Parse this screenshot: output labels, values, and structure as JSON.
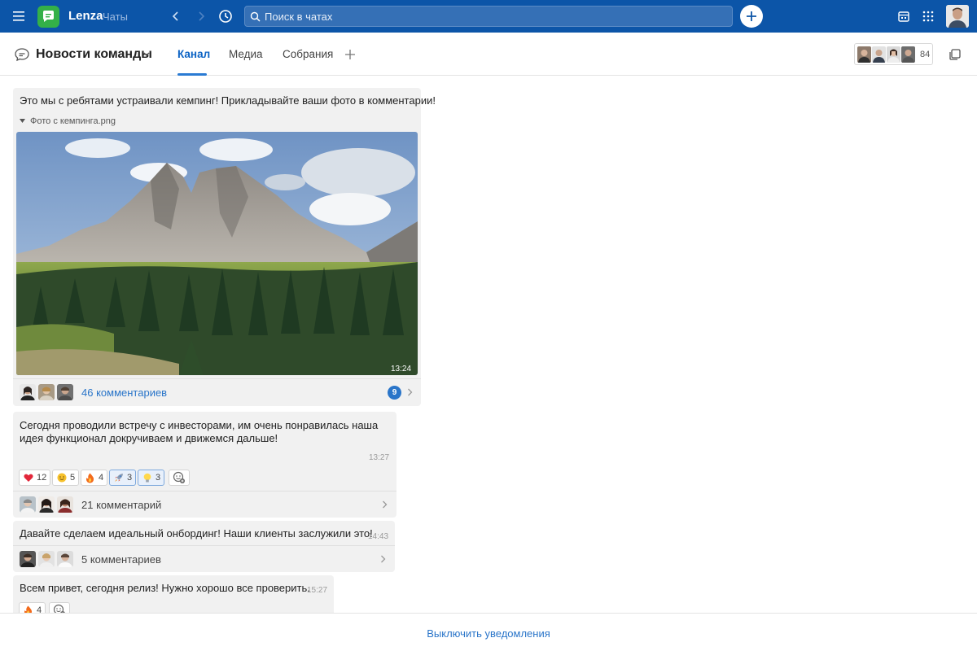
{
  "topbar": {
    "app_name": "Lenza",
    "app_section": "Чаты",
    "search_placeholder": "Поиск в чатах",
    "icons": [
      "menu-icon",
      "chat-logo-icon",
      "back-icon",
      "forward-icon",
      "history-icon",
      "search-icon",
      "plus-icon",
      "calendar-icon",
      "apps-grid-icon"
    ]
  },
  "channel": {
    "title": "Новости команды",
    "tabs": [
      {
        "label": "Канал",
        "active": true
      },
      {
        "label": "Медиа",
        "active": false
      },
      {
        "label": "Собрания",
        "active": false
      }
    ],
    "member_count": "84"
  },
  "messages": [
    {
      "text": "Это мы с ребятами устраивали кемпинг! Прикладывайте ваши фото в комментарии!",
      "file_name": "Фото с кемпинга.png",
      "time": "13:24",
      "comments_label": "46 комментариев",
      "unread": "9"
    },
    {
      "text": "Сегодня проводили встречу с инвесторами, им очень понравилась наша идея функционал докручиваем и движемся дальше!",
      "time": "13:27",
      "reactions": [
        {
          "emoji": "heart",
          "count": "12",
          "mine": false
        },
        {
          "emoji": "smile",
          "count": "5",
          "mine": false
        },
        {
          "emoji": "fire",
          "count": "4",
          "mine": false
        },
        {
          "emoji": "rocket",
          "count": "3",
          "mine": true
        },
        {
          "emoji": "bulb",
          "count": "3",
          "mine": true
        }
      ],
      "comments_label": "21 комментарий"
    },
    {
      "text": "Давайте сделаем идеальный онбординг! Наши клиенты заслужили это!",
      "time": "14:43",
      "comments_label": "5 комментариев"
    },
    {
      "text": "Всем привет, сегодня релиз! Нужно хорошо все проверить.",
      "time": "15:27",
      "reactions": [
        {
          "emoji": "fire",
          "count": "4",
          "mine": false
        }
      ]
    }
  ],
  "footer": {
    "mute_label": "Выключить уведомления"
  },
  "colors": {
    "topbar": "#0c55a8",
    "accent": "#2a75c9",
    "bubble": "#f1f1f1",
    "logo": "#34b048"
  }
}
